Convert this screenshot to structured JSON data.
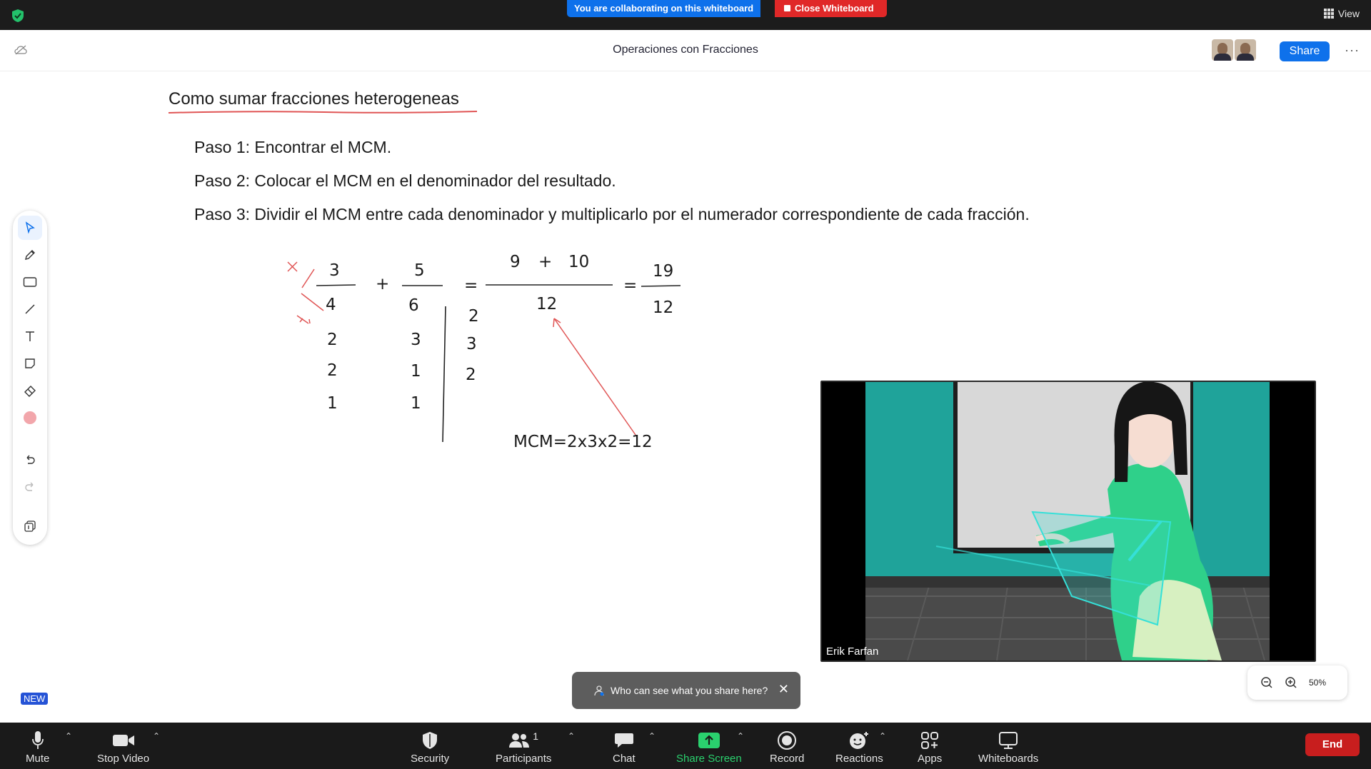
{
  "topbar": {
    "collab_text": "You are collaborating on this whiteboard",
    "close_whiteboard": "Close Whiteboard",
    "view_label": "View"
  },
  "header": {
    "title": "Operaciones con Fracciones",
    "share_label": "Share",
    "more_label": "···"
  },
  "whiteboard": {
    "heading": "Como sumar fracciones heterogeneas",
    "steps": [
      "Paso 1: Encontrar el MCM.",
      "Paso 2: Colocar el MCM en el denominador del resultado.",
      "Paso 3: Dividir el MCM entre cada denominador y multiplicarlo por el numerador correspondiente de cada fracción."
    ],
    "math": {
      "n1": "3",
      "d1": "4",
      "plus": "+",
      "n2": "5",
      "d2": "6",
      "eq": "=",
      "rnum_a": "9",
      "rplus": "+",
      "rnum_b": "10",
      "rden": "12",
      "eq2": "=",
      "final_num": "19",
      "final_den": "12",
      "factor_col1": [
        "2",
        "2",
        "1"
      ],
      "factor_col2": [
        "3",
        "1",
        "1"
      ],
      "primes": [
        "2",
        "3",
        "2"
      ],
      "mcm": "MCM=2x3x2=12"
    },
    "annotation_color": "#e05555"
  },
  "video": {
    "participant": "Erik Farfan"
  },
  "tooltip": {
    "text": "Who can see what you share here?",
    "close": "✕"
  },
  "new_badge": "NEW",
  "zoom": {
    "level": "50%"
  },
  "bottombar": {
    "mute": "Mute",
    "stop_video": "Stop Video",
    "security": "Security",
    "participants": "Participants",
    "participants_count": "1",
    "chat": "Chat",
    "share_screen": "Share Screen",
    "record": "Record",
    "reactions": "Reactions",
    "apps": "Apps",
    "whiteboards": "Whiteboards",
    "end": "End"
  },
  "colors": {
    "accent": "#0e71eb",
    "danger": "#e02828",
    "share_green": "#2ad16e",
    "toolbar_color_dot": "#f2a6ab"
  }
}
